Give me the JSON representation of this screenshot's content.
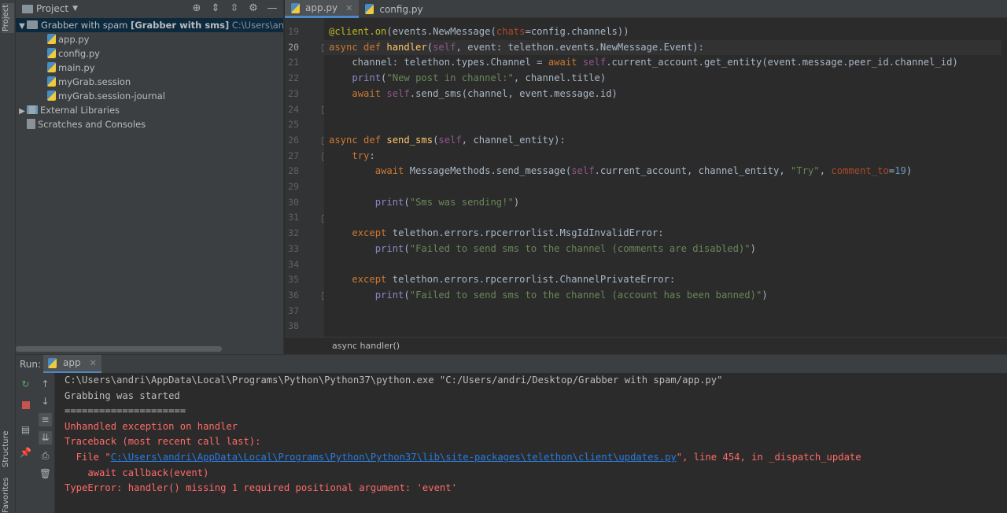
{
  "side_tabs": {
    "project": "Project",
    "structure": "Structure",
    "favorites": "Favorites"
  },
  "project_panel": {
    "title": "Project",
    "root": {
      "name": "Grabber with spam",
      "module": "[Grabber with sms]",
      "path": "C:\\Users\\andri\\Desktop"
    },
    "files": [
      "app.py",
      "config.py",
      "main.py",
      "myGrab.session",
      "myGrab.session-journal"
    ],
    "external_libraries": "External Libraries",
    "scratches": "Scratches and Consoles"
  },
  "editor": {
    "tabs": [
      {
        "label": "app.py",
        "active": true
      },
      {
        "label": "config.py",
        "active": false
      }
    ],
    "current_line": 20,
    "line_numbers": [
      "19",
      "20",
      "21",
      "22",
      "23",
      "24",
      "25",
      "26",
      "27",
      "28",
      "29",
      "30",
      "31",
      "32",
      "33",
      "34",
      "35",
      "36",
      "37",
      "38"
    ],
    "breadcrumb": "async handler()"
  },
  "run_panel": {
    "label": "Run:",
    "tab": "app",
    "output": {
      "cmd": "C:\\Users\\andri\\AppData\\Local\\Programs\\Python\\Python37\\python.exe \"C:/Users/andri/Desktop/Grabber with spam/app.py\"",
      "line1": "Grabbing was started",
      "line2": "=====================",
      "err1": "Unhandled exception on handler",
      "err2": "Traceback (most recent call last):",
      "file_prefix": "  File \"",
      "file_path": "C:\\Users\\andri\\AppData\\Local\\Programs\\Python\\Python37\\lib\\site-packages\\telethon\\client\\updates.py",
      "file_suffix": "\", line 454, in _dispatch_update",
      "err4": "    await callback(event)",
      "err5": "TypeError: handler() missing 1 required positional argument: 'event'"
    }
  },
  "colors": {
    "accent": "#4a88c7",
    "error": "#ff6b68",
    "link": "#287bde"
  }
}
